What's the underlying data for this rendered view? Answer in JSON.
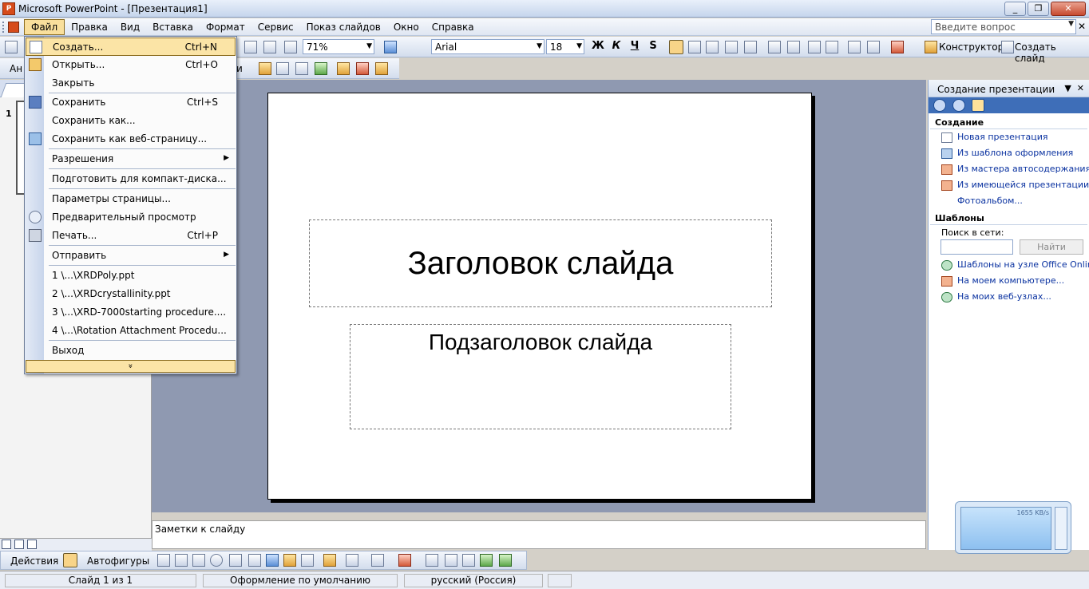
{
  "window": {
    "title": "Microsoft PowerPoint - [Презентация1]",
    "minimize": "_",
    "restore": "❐",
    "close": "✕"
  },
  "menubar": {
    "items": [
      "Файл",
      "Правка",
      "Вид",
      "Вставка",
      "Формат",
      "Сервис",
      "Показ слайдов",
      "Окно",
      "Справка"
    ],
    "help_placeholder": "Введите вопрос",
    "close_doc": "✕"
  },
  "toolbar": {
    "zoom": "71%",
    "font": "Arial",
    "font_size": "18",
    "bold": "Ж",
    "italic": "К",
    "underline": "Ч",
    "shadow": "S",
    "designer": "Конструктор",
    "new_slide": "Создать слайд",
    "toolbar2_left": "Ан",
    "toolbar2_mid": "и"
  },
  "file_menu": {
    "items": [
      {
        "label": "Создать...",
        "shortcut": "Ctrl+N",
        "highlighted": true
      },
      {
        "label": "Открыть...",
        "shortcut": "Ctrl+O"
      },
      {
        "label": "Закрыть",
        "shortcut": ""
      },
      {
        "label": "Сохранить",
        "shortcut": "Ctrl+S"
      },
      {
        "label": "Сохранить как...",
        "shortcut": ""
      },
      {
        "label": "Сохранить как веб-страницу...",
        "shortcut": ""
      },
      {
        "label": "Разрешения",
        "shortcut": ""
      },
      {
        "label": "Подготовить для компакт-диска...",
        "shortcut": ""
      },
      {
        "label": "Параметры страницы...",
        "shortcut": ""
      },
      {
        "label": "Предварительный просмотр",
        "shortcut": ""
      },
      {
        "label": "Печать...",
        "shortcut": "Ctrl+P"
      },
      {
        "label": "Отправить",
        "shortcut": ""
      },
      {
        "label": "1 \\...\\XRDPoly.ppt",
        "shortcut": ""
      },
      {
        "label": "2 \\...\\XRDcrystallinity.ppt",
        "shortcut": ""
      },
      {
        "label": "3 \\...\\XRD-7000starting procedure....",
        "shortcut": ""
      },
      {
        "label": "4 \\...\\Rotation Attachment Procedu...",
        "shortcut": ""
      },
      {
        "label": "Выход",
        "shortcut": ""
      }
    ],
    "expand": "»"
  },
  "slide_pane": {
    "slide_number": "1"
  },
  "slide": {
    "title": "Заголовок слайда",
    "subtitle": "Подзаголовок слайда"
  },
  "notes": {
    "placeholder": "Заметки к слайду"
  },
  "task_pane": {
    "title": "Создание презентации",
    "section_create": "Создание",
    "create_links": [
      "Новая презентация",
      "Из шаблона оформления",
      "Из мастера автосодержания...",
      "Из имеющейся презентации...",
      "Фотоальбом..."
    ],
    "section_templates": "Шаблоны",
    "search_label": "Поиск в сети:",
    "search_button": "Найти",
    "template_links": [
      "Шаблоны на узле Office Online",
      "На моем компьютере...",
      "На моих веб-узлах..."
    ]
  },
  "drawing_toolbar": {
    "actions": "Действия",
    "autoshapes": "Автофигуры"
  },
  "statusbar": {
    "slide": "Слайд 1 из 1",
    "design": "Оформление по умолчанию",
    "language": "русский (Россия)"
  },
  "net_widget": {
    "rate": "1655 KB/s"
  }
}
